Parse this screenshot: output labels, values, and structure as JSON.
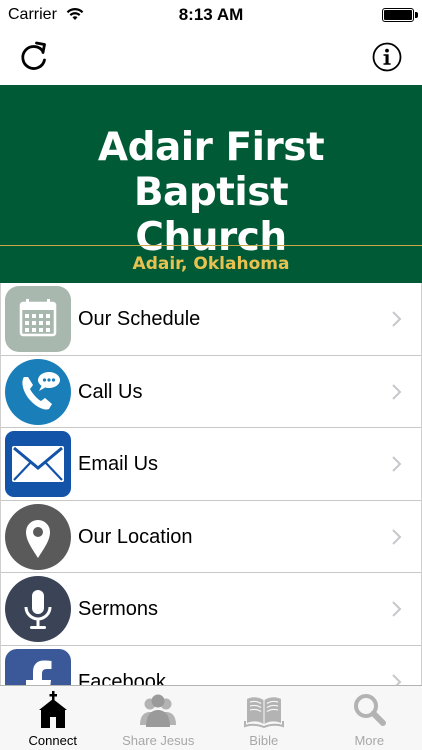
{
  "status_bar": {
    "carrier": "Carrier",
    "time": "8:13 AM"
  },
  "nav": {
    "refresh_icon": "refresh-icon",
    "info_icon": "info-icon"
  },
  "banner": {
    "title_line1": "Adair First Baptist",
    "title_line2": "Church",
    "subtitle": "Adair, Oklahoma",
    "background_color": "#005a35",
    "accent_color": "#e8c250"
  },
  "menu": {
    "items": [
      {
        "label": "Our Schedule",
        "icon": "calendar-icon",
        "icon_color": "#a9b8ae"
      },
      {
        "label": "Call Us",
        "icon": "phone-icon",
        "icon_color": "#1a7fb8"
      },
      {
        "label": "Email Us",
        "icon": "envelope-icon",
        "icon_color": "#1354a8"
      },
      {
        "label": "Our Location",
        "icon": "location-pin-icon",
        "icon_color": "#5a5a5a"
      },
      {
        "label": "Sermons",
        "icon": "microphone-icon",
        "icon_color": "#3a4456"
      },
      {
        "label": "Facebook",
        "icon": "facebook-icon",
        "icon_color": "#3b5998"
      }
    ]
  },
  "tabs": [
    {
      "label": "Connect",
      "icon": "church-icon",
      "active": true
    },
    {
      "label": "Share Jesus",
      "icon": "people-icon",
      "active": false
    },
    {
      "label": "Bible",
      "icon": "book-icon",
      "active": false
    },
    {
      "label": "More",
      "icon": "search-icon",
      "active": false
    }
  ]
}
